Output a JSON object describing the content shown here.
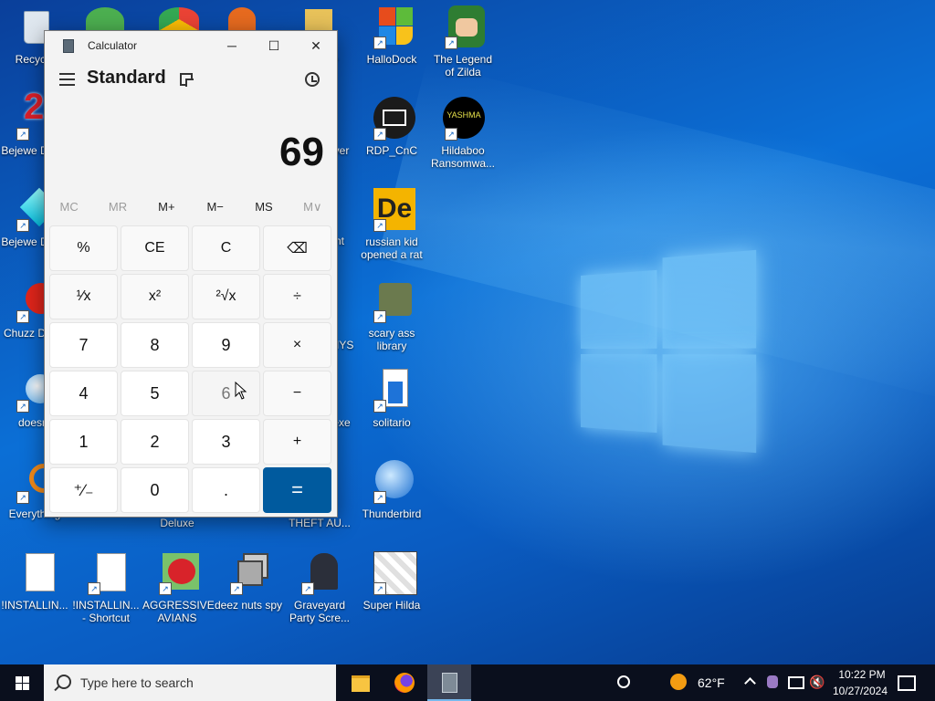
{
  "desktop": {
    "icons": [
      {
        "label": "Recycle Bin",
        "shown": "Recycle"
      },
      {
        "label": "HalloDock"
      },
      {
        "label": "The Legend of Zilda"
      },
      {
        "label": "Bejeweled 2 Deluxe",
        "shown": "Bejewe Delux"
      },
      {
        "label": "RDP_CnC"
      },
      {
        "label": "Hildaboo Ransomwa..."
      },
      {
        "label": "russian kid opened a rat"
      },
      {
        "label": "Bejeweled Deluxe",
        "shown": "Bejewe Delux"
      },
      {
        "label": "Chuzzle Deluxe",
        "shown": "Chuzz Delux"
      },
      {
        "label": "scary ass library"
      },
      {
        "label": "doesnt",
        "shown": "doesnt"
      },
      {
        "label": "solitario"
      },
      {
        "label": "Everything",
        "shown": "Everything"
      },
      {
        "label": "Thunderbird"
      },
      {
        "label": "!INSTALLIN..."
      },
      {
        "label": "!INSTALLIN... - Shortcut"
      },
      {
        "label": "AGGRESSIVE AVIANS"
      },
      {
        "label": "deez nuts spy"
      },
      {
        "label": "Graveyard Party Scre..."
      },
      {
        "label": "Super Hilda"
      },
      {
        "label": "Deluxe",
        "shown": "Deluxe"
      },
      {
        "label": "THEFT AU...",
        "shown": "THEFT AU..."
      }
    ],
    "partial_labels": {
      "ver": "ver",
      "nt": "nt",
      "hys": "HYS",
      "exe": "exe",
      "y": "y"
    }
  },
  "calculator": {
    "title": "Calculator",
    "mode": "Standard",
    "display": "69",
    "memory": [
      {
        "label": "MC",
        "enabled": false
      },
      {
        "label": "MR",
        "enabled": false
      },
      {
        "label": "M+",
        "enabled": true
      },
      {
        "label": "M−",
        "enabled": true
      },
      {
        "label": "MS",
        "enabled": true
      },
      {
        "label": "M∨",
        "enabled": false
      }
    ],
    "keys": [
      {
        "label": "%",
        "name": "percent"
      },
      {
        "label": "CE",
        "name": "clear-entry"
      },
      {
        "label": "C",
        "name": "clear"
      },
      {
        "label": "⌫",
        "name": "backspace"
      },
      {
        "label": "¹⁄x",
        "name": "reciprocal"
      },
      {
        "label": "x²",
        "name": "square"
      },
      {
        "label": "²√x",
        "name": "square-root"
      },
      {
        "label": "÷",
        "name": "divide"
      },
      {
        "label": "7",
        "name": "seven"
      },
      {
        "label": "8",
        "name": "eight"
      },
      {
        "label": "9",
        "name": "nine"
      },
      {
        "label": "×",
        "name": "multiply"
      },
      {
        "label": "4",
        "name": "four"
      },
      {
        "label": "5",
        "name": "five"
      },
      {
        "label": "6",
        "name": "six"
      },
      {
        "label": "−",
        "name": "subtract"
      },
      {
        "label": "1",
        "name": "one"
      },
      {
        "label": "2",
        "name": "two"
      },
      {
        "label": "3",
        "name": "three"
      },
      {
        "label": "+",
        "name": "add"
      },
      {
        "label": "⁺∕₋",
        "name": "negate"
      },
      {
        "label": "0",
        "name": "zero"
      },
      {
        "label": ".",
        "name": "decimal"
      },
      {
        "label": "=",
        "name": "equals"
      }
    ]
  },
  "taskbar": {
    "search_placeholder": "Type here to search",
    "weather": "62°F",
    "time": "10:22 PM",
    "date": "10/27/2024"
  },
  "colors": {
    "accent": "#005a9e",
    "taskbar": "#0a0f1d"
  }
}
